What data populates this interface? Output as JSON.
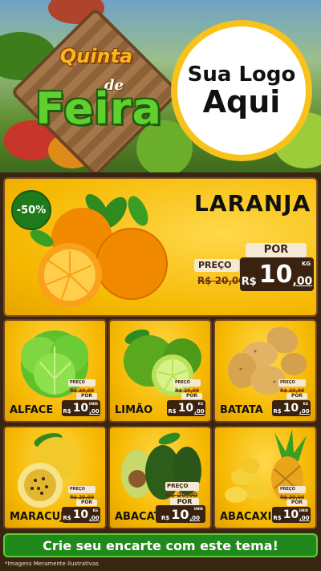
{
  "header": {
    "title_top": "Quinta",
    "title_de": "de",
    "title_main": "Feira",
    "logo_line1": "Sua Logo",
    "logo_line2": "Aqui"
  },
  "hero": {
    "discount": "-50%",
    "name": "LARANJA",
    "preco_label": "PREÇO",
    "old_price": "R$ 20,00",
    "por_label": "POR",
    "currency": "R$",
    "price_int": "10",
    "price_dec": ",00",
    "unit": "KG"
  },
  "products": [
    {
      "name": "ALFACE",
      "preco_label": "PREÇO",
      "old_price": "R$ 20,00",
      "por_label": "POR",
      "currency": "R$",
      "price_int": "10",
      "price_dec": ",00",
      "unit": "UNID"
    },
    {
      "name": "LIMÃO",
      "preco_label": "PREÇO",
      "old_price": "R$ 20,00",
      "por_label": "POR",
      "currency": "R$",
      "price_int": "10",
      "price_dec": ",00",
      "unit": "KG"
    },
    {
      "name": "BATATA",
      "preco_label": "PREÇO",
      "old_price": "R$ 20,00",
      "por_label": "POR",
      "currency": "R$",
      "price_int": "10",
      "price_dec": ",00",
      "unit": "KG"
    },
    {
      "name": "MARACUJÁ",
      "preco_label": "PREÇO",
      "old_price": "R$ 20,00",
      "por_label": "POR",
      "currency": "R$",
      "price_int": "10",
      "price_dec": ",00",
      "unit": "KG"
    },
    {
      "name": "ABACATE",
      "preco_label": "PREÇO",
      "old_price": "R$ 20,00",
      "por_label": "POR",
      "currency": "R$",
      "price_int": "10",
      "price_dec": ",00",
      "unit": "UNID"
    },
    {
      "name": "ABACAXI",
      "preco_label": "PREÇO",
      "old_price": "R$ 20,00",
      "por_label": "POR",
      "currency": "R$",
      "price_int": "10",
      "price_dec": ",00",
      "unit": "UNID"
    }
  ],
  "footer": {
    "cta": "Crie seu encarte com este tema!",
    "disclaimer": "*Imagens Meramente Ilustrativas"
  },
  "colors": {
    "gold": "#f5b800",
    "wood": "#3b2210",
    "green": "#21891c",
    "logo_ring": "#f7c21a"
  }
}
